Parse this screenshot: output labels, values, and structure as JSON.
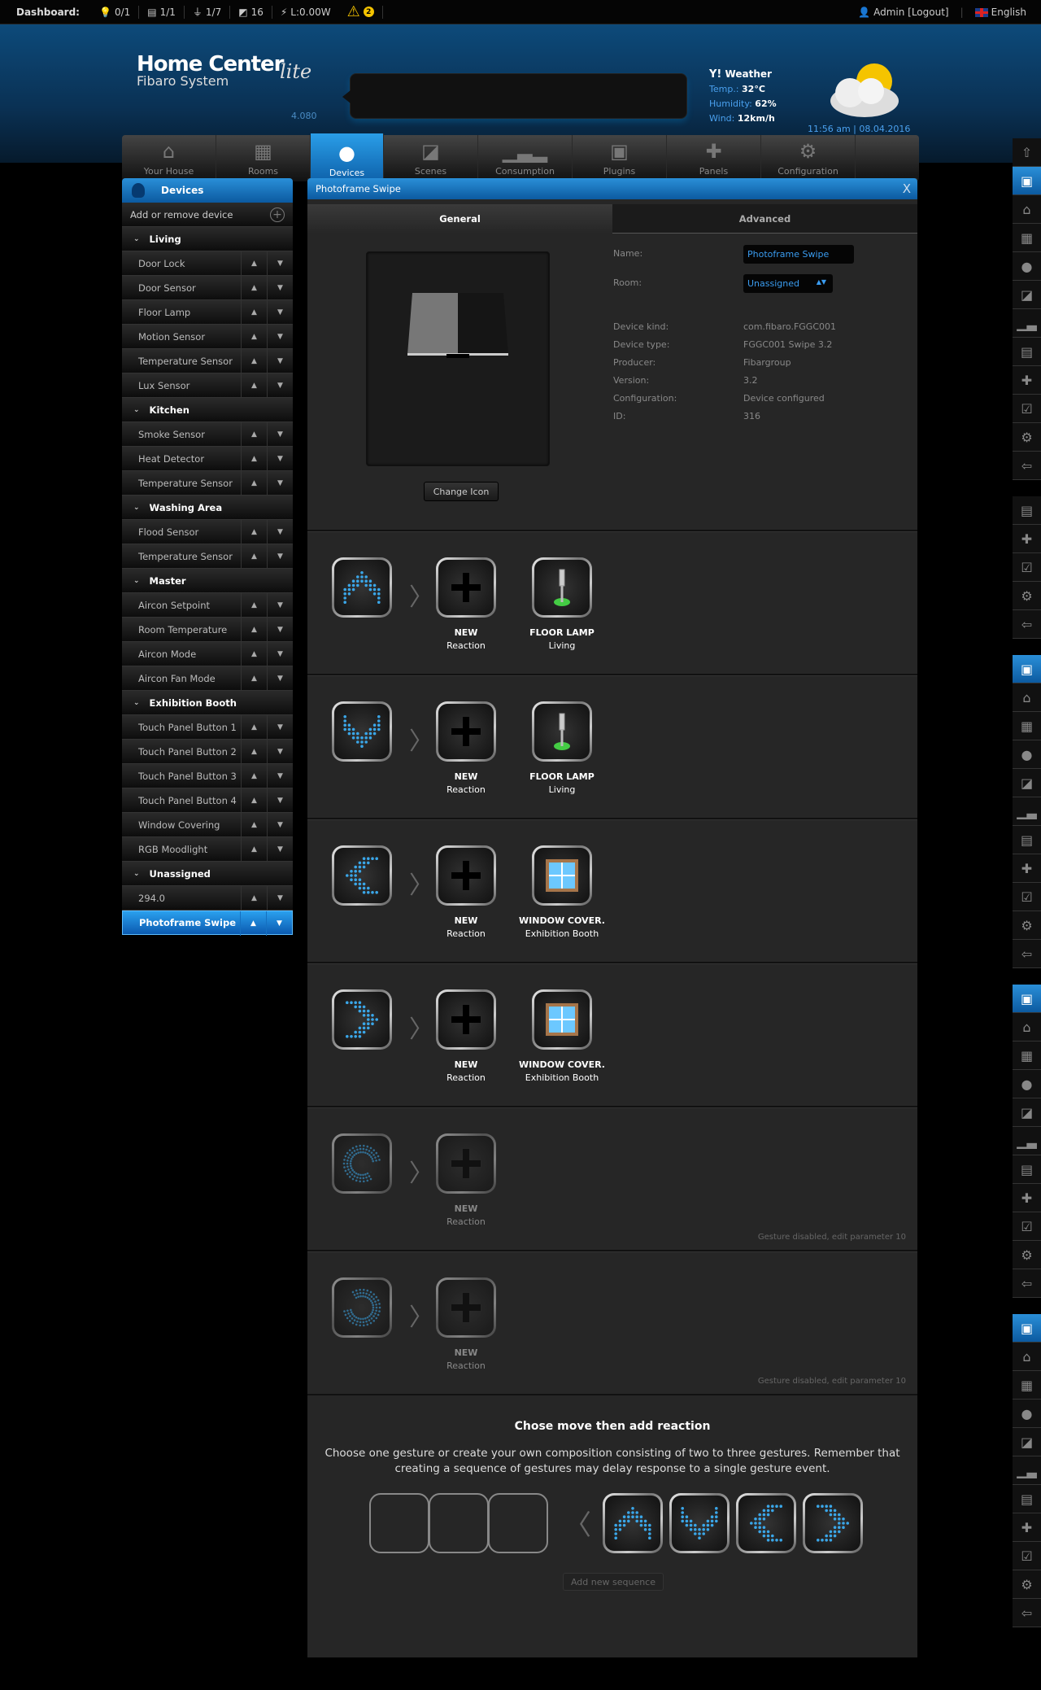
{
  "topbar": {
    "dashboard_label": "Dashboard:",
    "stats": [
      {
        "icon": "bulb-icon",
        "glyph": "💡",
        "value": "0/1"
      },
      {
        "icon": "blind-icon",
        "glyph": "▤",
        "value": "1/1"
      },
      {
        "icon": "plug-icon",
        "glyph": "⏚",
        "value": "1/7"
      },
      {
        "icon": "scene-icon",
        "glyph": "◩",
        "value": "16"
      },
      {
        "icon": "lightning-icon",
        "glyph": "⚡",
        "value": "L:0.00W"
      }
    ],
    "warnings": "2",
    "user": "Admin [Logout]",
    "language": "English"
  },
  "header": {
    "title": "Home Center",
    "subtitle": "Fibaro System",
    "edition": "lite",
    "version": "4.080",
    "weather": {
      "provider": "Weather",
      "temp_label": "Temp.:",
      "temp": "32°C",
      "humidity_label": "Humidity:",
      "humidity": "62%",
      "wind_label": "Wind:",
      "wind": "12km/h",
      "datetime": "11:56 am | 08.04.2016"
    }
  },
  "nav": [
    {
      "label": "Your House",
      "icon": "house-icon",
      "glyph": "⌂"
    },
    {
      "label": "Rooms",
      "icon": "rooms-icon",
      "glyph": "▦"
    },
    {
      "label": "Devices",
      "icon": "bulb-icon",
      "glyph": "●",
      "active": true
    },
    {
      "label": "Scenes",
      "icon": "clapper-icon",
      "glyph": "◪"
    },
    {
      "label": "Consumption",
      "icon": "chart-icon",
      "glyph": "▁▃▂"
    },
    {
      "label": "Plugins",
      "icon": "plugin-box-icon",
      "glyph": "▣"
    },
    {
      "label": "Panels",
      "icon": "puzzle-icon",
      "glyph": "✚"
    },
    {
      "label": "Configuration",
      "icon": "gears-icon",
      "glyph": "⚙"
    }
  ],
  "sidebar": {
    "title": "Devices",
    "add_label": "Add or remove device",
    "items": [
      {
        "type": "group",
        "label": "Living"
      },
      {
        "type": "device",
        "label": "Door Lock"
      },
      {
        "type": "device",
        "label": "Door Sensor"
      },
      {
        "type": "device",
        "label": "Floor Lamp"
      },
      {
        "type": "device",
        "label": "Motion Sensor"
      },
      {
        "type": "device",
        "label": "Temperature Sensor"
      },
      {
        "type": "device",
        "label": "Lux Sensor"
      },
      {
        "type": "group",
        "label": "Kitchen"
      },
      {
        "type": "device",
        "label": "Smoke Sensor"
      },
      {
        "type": "device",
        "label": "Heat Detector"
      },
      {
        "type": "device",
        "label": "Temperature Sensor"
      },
      {
        "type": "group",
        "label": "Washing Area"
      },
      {
        "type": "device",
        "label": "Flood Sensor"
      },
      {
        "type": "device",
        "label": "Temperature Sensor"
      },
      {
        "type": "group",
        "label": "Master"
      },
      {
        "type": "device",
        "label": "Aircon Setpoint"
      },
      {
        "type": "device",
        "label": "Room Temperature"
      },
      {
        "type": "device",
        "label": "Aircon Mode"
      },
      {
        "type": "device",
        "label": "Aircon Fan Mode"
      },
      {
        "type": "group",
        "label": "Exhibition Booth"
      },
      {
        "type": "device",
        "label": "Touch Panel Button 1"
      },
      {
        "type": "device",
        "label": "Touch Panel Button 2"
      },
      {
        "type": "device",
        "label": "Touch Panel Button 3"
      },
      {
        "type": "device",
        "label": "Touch Panel Button 4"
      },
      {
        "type": "device",
        "label": "Window Covering"
      },
      {
        "type": "device",
        "label": "RGB Moodlight"
      },
      {
        "type": "group",
        "label": "Unassigned"
      },
      {
        "type": "device",
        "label": "294.0"
      },
      {
        "type": "device",
        "label": "Photoframe Swipe",
        "selected": true
      }
    ]
  },
  "panel": {
    "title": "Photoframe Swipe",
    "close": "X",
    "tabs": [
      "General",
      "Advanced"
    ],
    "change_icon": "Change Icon",
    "name_label": "Name:",
    "name_value": "Photoframe Swipe",
    "room_label": "Room:",
    "room_value": "Unassigned",
    "props": [
      {
        "label": "Device kind:",
        "value": "com.fibaro.FGGC001"
      },
      {
        "label": "Device type:",
        "value": "FGGC001 Swipe 3.2"
      },
      {
        "label": "Producer:",
        "value": "Fibargroup"
      },
      {
        "label": "Version:",
        "value": "3.2"
      },
      {
        "label": "Configuration:",
        "value": "Device configured"
      },
      {
        "label": "ID:",
        "value": "316"
      }
    ]
  },
  "gestures": [
    {
      "gesture": "up",
      "reactions": [
        {
          "title": "NEW",
          "sub": "Reaction",
          "icon": "plus"
        },
        {
          "title": "FLOOR LAMP",
          "sub": "Living",
          "icon": "lamp"
        }
      ]
    },
    {
      "gesture": "down",
      "reactions": [
        {
          "title": "NEW",
          "sub": "Reaction",
          "icon": "plus"
        },
        {
          "title": "FLOOR LAMP",
          "sub": "Living",
          "icon": "lamp"
        }
      ]
    },
    {
      "gesture": "left",
      "reactions": [
        {
          "title": "NEW",
          "sub": "Reaction",
          "icon": "plus"
        },
        {
          "title": "WINDOW COVER.",
          "sub": "Exhibition Booth",
          "icon": "window"
        }
      ]
    },
    {
      "gesture": "right",
      "reactions": [
        {
          "title": "NEW",
          "sub": "Reaction",
          "icon": "plus"
        },
        {
          "title": "WINDOW COVER.",
          "sub": "Exhibition Booth",
          "icon": "window"
        }
      ]
    },
    {
      "gesture": "cw",
      "disabled": true,
      "note": "Gesture disabled, edit parameter 10",
      "reactions": [
        {
          "title": "NEW",
          "sub": "Reaction",
          "icon": "plus"
        }
      ]
    },
    {
      "gesture": "ccw",
      "disabled": true,
      "note": "Gesture disabled, edit parameter 10",
      "reactions": [
        {
          "title": "NEW",
          "sub": "Reaction",
          "icon": "plus"
        }
      ]
    }
  ],
  "composer": {
    "title": "Chose move then add reaction",
    "text": "Choose one gesture or create your own composition consisting of two to three gestures. Remember that creating a sequence of gestures may delay response to a single gesture event.",
    "palette": [
      "up",
      "down",
      "left",
      "right"
    ],
    "add_button": "Add new sequence"
  },
  "dock": [
    [
      "up-arrow",
      "save",
      "house",
      "rooms",
      "bulb",
      "scenes",
      "chart",
      "plugins",
      "puzzle",
      "panels",
      "gears",
      "exit"
    ],
    [
      "plugins",
      "puzzle",
      "panels",
      "gears",
      "exit"
    ],
    [
      "save",
      "house",
      "rooms",
      "bulb",
      "scenes",
      "chart",
      "plugins",
      "puzzle",
      "panels",
      "gears",
      "exit"
    ],
    [
      "save",
      "house",
      "rooms",
      "bulb",
      "scenes",
      "chart",
      "plugins",
      "puzzle",
      "panels",
      "gears",
      "exit"
    ],
    [
      "save",
      "house",
      "rooms",
      "bulb",
      "scenes",
      "chart",
      "plugins",
      "puzzle",
      "panels",
      "gears",
      "exit"
    ]
  ],
  "colors": {
    "accent": "#1a7fd0",
    "gesture_dot": "#3aa6e8",
    "link": "#3a9cf0"
  }
}
